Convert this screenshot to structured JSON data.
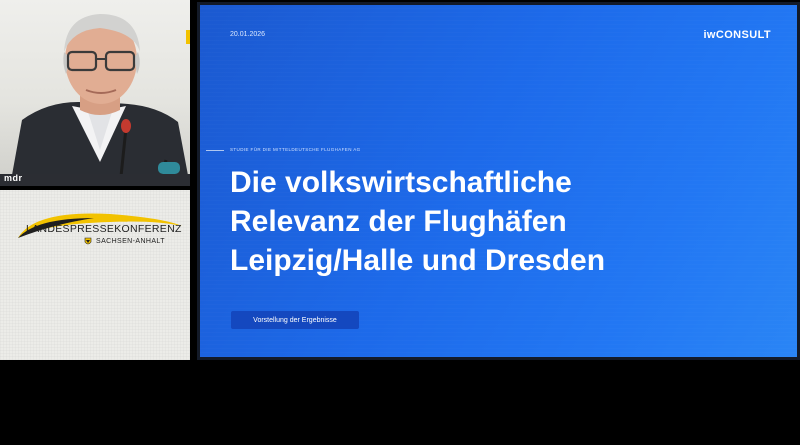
{
  "speaker_panel": {
    "broadcaster_badge": "mdr"
  },
  "banner_panel": {
    "title": "LANDESPRESSEKONFERENZ",
    "subtitle": "SACHSEN-ANHALT"
  },
  "slide": {
    "date": "20.01.2026",
    "logo": "iwCONSULT",
    "kicker": "STUDIE FÜR DIE MITTELDEUTSCHE FLUGHAFEN AG",
    "headline": [
      "Die volkswirtschaftliche",
      "Relevanz der Flughäfen",
      "Leipzig/Halle und Dresden"
    ],
    "cta_label": "Vorstellung der Ergebnisse"
  },
  "colors": {
    "slide_blue": "#1d6aea",
    "button_blue": "#1448bf",
    "banner_gold": "#f2c200"
  }
}
